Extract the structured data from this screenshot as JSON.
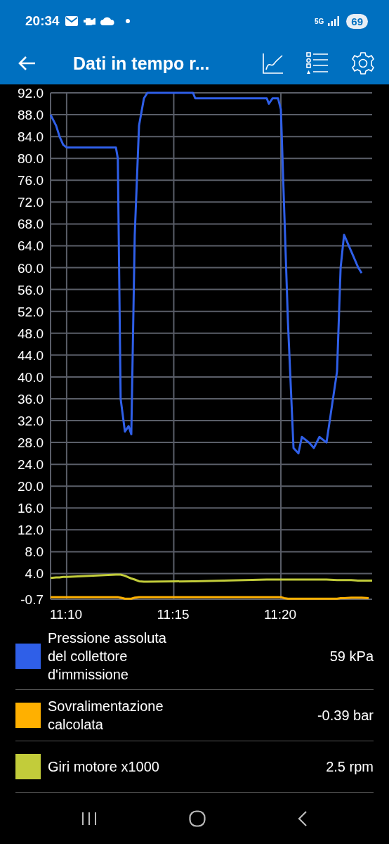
{
  "status_bar": {
    "time": "20:34",
    "network": "5G",
    "battery": "69"
  },
  "app_bar": {
    "title": "Dati in tempo r..."
  },
  "chart_data": {
    "type": "line",
    "grid": true,
    "ylim": [
      -0.7,
      92
    ],
    "xlim": [
      669.25,
      684.26
    ],
    "yticks": [
      {
        "value": 92,
        "label": "92.0"
      },
      {
        "value": 88,
        "label": "88.0"
      },
      {
        "value": 84,
        "label": "84.0"
      },
      {
        "value": 80,
        "label": "80.0"
      },
      {
        "value": 76,
        "label": "76.0"
      },
      {
        "value": 72,
        "label": "72.0"
      },
      {
        "value": 68,
        "label": "68.0"
      },
      {
        "value": 64,
        "label": "64.0"
      },
      {
        "value": 60,
        "label": "60.0"
      },
      {
        "value": 56,
        "label": "56.0"
      },
      {
        "value": 52,
        "label": "52.0"
      },
      {
        "value": 48,
        "label": "48.0"
      },
      {
        "value": 44,
        "label": "44.0"
      },
      {
        "value": 40,
        "label": "40.0"
      },
      {
        "value": 36,
        "label": "36.0"
      },
      {
        "value": 32,
        "label": "32.0"
      },
      {
        "value": 28,
        "label": "28.0"
      },
      {
        "value": 24,
        "label": "24.0"
      },
      {
        "value": 20,
        "label": "20.0"
      },
      {
        "value": 16,
        "label": "16.0"
      },
      {
        "value": 12,
        "label": "12.0"
      },
      {
        "value": 8,
        "label": "8.0"
      },
      {
        "value": 4,
        "label": "4.0"
      },
      {
        "value": -0.7,
        "label": "-0.7"
      }
    ],
    "xticks": [
      {
        "value": 670,
        "label": "11:10"
      },
      {
        "value": 675,
        "label": "11:15"
      },
      {
        "value": 680,
        "label": "11:20"
      }
    ],
    "x": [
      669.25,
      669.51,
      669.67,
      669.84,
      670,
      672.3,
      672.39,
      672.52,
      672.72,
      672.89,
      673.02,
      673.18,
      673.38,
      673.61,
      673.77,
      675.9,
      676,
      679.34,
      679.44,
      679.61,
      679.87,
      680,
      680.16,
      680.33,
      680.59,
      680.82,
      680.98,
      681.31,
      681.54,
      681.8,
      682.13,
      682.62,
      682.79,
      682.95,
      683.28,
      683.61,
      683.77,
      684.1,
      684.26
    ],
    "series": [
      {
        "name": "Pressione assoluta del collettore d'immissione",
        "color": "#2f5fe8",
        "values": [
          88,
          86,
          84,
          82.5,
          82,
          82,
          80,
          36,
          30,
          31,
          29.5,
          66,
          86,
          91,
          92,
          92,
          91,
          91,
          90,
          91,
          91,
          89,
          70,
          50,
          27,
          26,
          29,
          28,
          27,
          29,
          28,
          41,
          60,
          66,
          63,
          60,
          59,
          null,
          null
        ]
      },
      {
        "name": "Sovralimentazione calcolata",
        "color": "#ffb000",
        "values": [
          -0.3,
          -0.3,
          -0.3,
          -0.3,
          -0.3,
          -0.3,
          -0.3,
          -0.4,
          -0.6,
          -0.6,
          -0.6,
          -0.4,
          -0.3,
          -0.3,
          -0.3,
          -0.3,
          -0.3,
          -0.3,
          -0.3,
          -0.3,
          -0.3,
          -0.3,
          -0.5,
          -0.6,
          -0.6,
          -0.6,
          -0.6,
          -0.6,
          -0.6,
          -0.6,
          -0.6,
          -0.6,
          -0.5,
          -0.5,
          -0.4,
          -0.4,
          -0.4,
          -0.5,
          null
        ]
      },
      {
        "name": "Giri motore x1000",
        "color": "#c2cc3a",
        "values": [
          3.2,
          3.3,
          3.3,
          3.4,
          3.4,
          3.8,
          3.8,
          3.8,
          3.6,
          3.3,
          3.1,
          2.9,
          2.6,
          2.5,
          2.5,
          2.6,
          2.6,
          2.9,
          2.9,
          2.9,
          2.9,
          2.9,
          2.9,
          2.9,
          2.9,
          2.9,
          2.9,
          2.9,
          2.9,
          2.9,
          2.9,
          2.8,
          2.8,
          2.8,
          2.8,
          2.7,
          2.7,
          2.7,
          2.7
        ]
      }
    ]
  },
  "legend": [
    {
      "value": "59 kPa"
    },
    {
      "value": "-0.39 bar"
    },
    {
      "value": "2.5 rpm"
    }
  ]
}
